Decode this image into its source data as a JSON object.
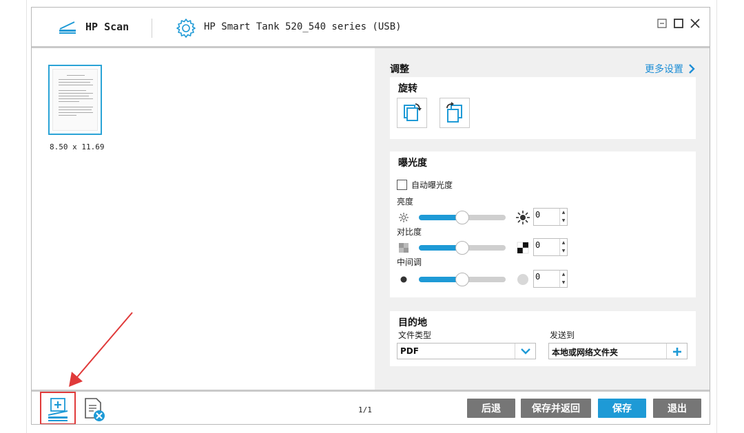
{
  "window": {
    "app_name": "HP Scan",
    "device_name": "HP Smart Tank 520_540 series (USB)"
  },
  "preview": {
    "thumbnail_size": "8.50 x 11.69"
  },
  "panel": {
    "title": "调整",
    "more_settings": "更多设置",
    "rotate": {
      "title": "旋转"
    },
    "exposure": {
      "title": "曝光度",
      "auto_label": "自动曝光度",
      "auto_checked": false,
      "sliders": [
        {
          "label": "亮度",
          "value": "0",
          "level": 0.5
        },
        {
          "label": "对比度",
          "value": "0",
          "level": 0.5
        },
        {
          "label": "中间调",
          "value": "0",
          "level": 0.5
        }
      ]
    },
    "destination": {
      "title": "目的地",
      "file_type_label": "文件类型",
      "file_type_value": "PDF",
      "send_to_label": "发送到",
      "send_to_value": "本地或网络文件夹"
    }
  },
  "bottom": {
    "page_indicator": "1/1",
    "back": "后退",
    "save_and_return": "保存并返回",
    "save": "保存",
    "exit": "退出"
  },
  "colors": {
    "accent": "#1e9ad6",
    "gray_button": "#767676",
    "highlight": "#e03a3a"
  }
}
